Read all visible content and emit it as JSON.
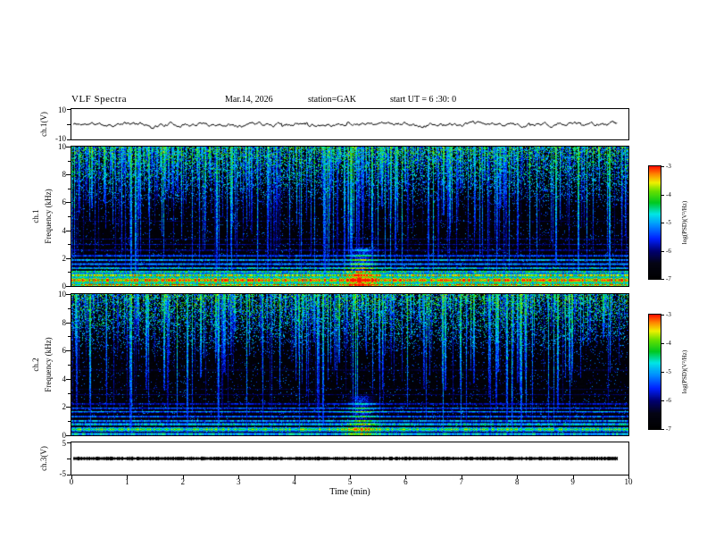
{
  "title": {
    "main": "VLF Spectra",
    "date": "Mar.14, 2026",
    "station": "station=GAK",
    "start_ut": "start UT =  6 :30: 0"
  },
  "x_axis": {
    "label": "Time (min)",
    "min": 0,
    "max": 10,
    "ticks": [
      "0",
      "1",
      "2",
      "3",
      "4",
      "5",
      "6",
      "7",
      "8",
      "9",
      "10"
    ]
  },
  "panels": [
    {
      "id": "ch1_wave",
      "ylabel": "ch.1(V)",
      "ymin": -10,
      "ymax": 10,
      "ytick_labels": [
        "10",
        "-10"
      ]
    },
    {
      "id": "ch1_spec",
      "channel": "ch.1",
      "ylabel": "Frequency (kHz)",
      "ymin": 0,
      "ymax": 10,
      "ytick_labels": [
        "10",
        "8",
        "6",
        "4",
        "2",
        "0"
      ]
    },
    {
      "id": "ch2_spec",
      "channel": "ch.2",
      "ylabel": "Frequency (kHz)",
      "ymin": 0,
      "ymax": 10,
      "ytick_labels": [
        "10",
        "8",
        "6",
        "4",
        "2",
        "0"
      ]
    },
    {
      "id": "ch3_wave",
      "ylabel": "ch.3(V)",
      "ymin": -5,
      "ymax": 5,
      "ytick_labels": [
        "5",
        "-5"
      ]
    }
  ],
  "colorbar": {
    "label": "log(PSD)(V²/Hz)",
    "ticks": [
      "-3",
      "-4",
      "-5",
      "-6",
      "-7"
    ],
    "zmin": -7,
    "zmax": -3,
    "colormap": [
      {
        "v": 0.0,
        "c": "#000000"
      },
      {
        "v": 0.14,
        "c": "#040414"
      },
      {
        "v": 0.25,
        "c": "#00006e"
      },
      {
        "v": 0.36,
        "c": "#0020ff"
      },
      {
        "v": 0.48,
        "c": "#0090ff"
      },
      {
        "v": 0.58,
        "c": "#00e6e6"
      },
      {
        "v": 0.68,
        "c": "#00c820"
      },
      {
        "v": 0.78,
        "c": "#66e000"
      },
      {
        "v": 0.86,
        "c": "#f0f000"
      },
      {
        "v": 0.93,
        "c": "#ff8c00"
      },
      {
        "v": 1.0,
        "c": "#ff1400"
      }
    ]
  },
  "chart_data": [
    {
      "type": "line",
      "name": "ch.1 waveform",
      "x_range_min": [
        0,
        9.8
      ],
      "ylim": [
        -10,
        10
      ],
      "y_unit": "V",
      "signal": {
        "kind": "broadband-noise",
        "mean_V": 0,
        "amplitude_V": 2,
        "seed": 11
      }
    },
    {
      "type": "heatmap",
      "name": "ch.1 spectrogram",
      "x_range_min": [
        0,
        10
      ],
      "freq_range_kHz": [
        0,
        10
      ],
      "zlim": [
        -7,
        -3
      ],
      "z_label": "log(PSD)(V²/Hz)",
      "seed": 7,
      "streaks": {
        "count": 360,
        "description": "vertical impulsive sferic streaks descending from 10 kHz"
      },
      "top_activity": {
        "start_kHz": 5.5,
        "density": 0.55
      },
      "burst": {
        "t_min": 5.2,
        "sigma_min": 0.18,
        "max_freq_kHz": 2.8,
        "strength": 0.5
      },
      "bands": [
        {
          "f": 0.12,
          "w": 0.1,
          "s": 0.95
        },
        {
          "f": 0.45,
          "w": 0.2,
          "s": 1.0
        },
        {
          "f": 0.8,
          "w": 0.12,
          "s": 0.88
        },
        {
          "f": 1.05,
          "w": 0.09,
          "s": 0.72
        },
        {
          "f": 1.3,
          "w": 0.08,
          "s": 0.62
        },
        {
          "f": 1.6,
          "w": 0.07,
          "s": 0.55
        },
        {
          "f": 1.9,
          "w": 0.07,
          "s": 0.58
        },
        {
          "f": 2.2,
          "w": 0.06,
          "s": 0.48
        },
        {
          "f": 2.6,
          "w": 0.05,
          "s": 0.34
        },
        {
          "f": 3.0,
          "w": 0.05,
          "s": 0.3
        },
        {
          "f": 3.4,
          "w": 0.04,
          "s": 0.24
        },
        {
          "f": 4.7,
          "w": 0.04,
          "s": 0.26
        },
        {
          "f": 6.2,
          "w": 0.04,
          "s": 0.2
        },
        {
          "f": 7.6,
          "w": 0.03,
          "s": 0.16
        }
      ]
    },
    {
      "type": "heatmap",
      "name": "ch.2 spectrogram",
      "x_range_min": [
        0,
        10
      ],
      "freq_range_kHz": [
        0,
        10
      ],
      "zlim": [
        -7,
        -3
      ],
      "z_label": "log(PSD)(V²/Hz)",
      "seed": 13,
      "streaks": {
        "count": 330,
        "description": "vertical impulsive sferic streaks descending from 10 kHz"
      },
      "top_activity": {
        "start_kHz": 5.5,
        "density": 0.5
      },
      "burst": {
        "t_min": 5.2,
        "sigma_min": 0.18,
        "max_freq_kHz": 2.8,
        "strength": 0.45
      },
      "bands": [
        {
          "f": 0.12,
          "w": 0.1,
          "s": 0.62
        },
        {
          "f": 0.45,
          "w": 0.16,
          "s": 0.72
        },
        {
          "f": 0.8,
          "w": 0.1,
          "s": 0.62
        },
        {
          "f": 1.05,
          "w": 0.08,
          "s": 0.55
        },
        {
          "f": 1.35,
          "w": 0.07,
          "s": 0.5
        },
        {
          "f": 1.7,
          "w": 0.06,
          "s": 0.52
        },
        {
          "f": 1.95,
          "w": 0.06,
          "s": 0.46
        },
        {
          "f": 2.25,
          "w": 0.05,
          "s": 0.4
        },
        {
          "f": 2.9,
          "w": 0.04,
          "s": 0.26
        },
        {
          "f": 3.3,
          "w": 0.04,
          "s": 0.2
        },
        {
          "f": 4.65,
          "w": 0.04,
          "s": 0.26
        },
        {
          "f": 6.1,
          "w": 0.03,
          "s": 0.18
        }
      ]
    },
    {
      "type": "line",
      "name": "ch.3 waveform",
      "x_range_min": [
        0,
        9.8
      ],
      "ylim": [
        -5,
        5
      ],
      "y_unit": "V",
      "signal": {
        "kind": "flat",
        "value_V": 0,
        "thickness_V": 0.8,
        "seed": 21
      }
    }
  ]
}
